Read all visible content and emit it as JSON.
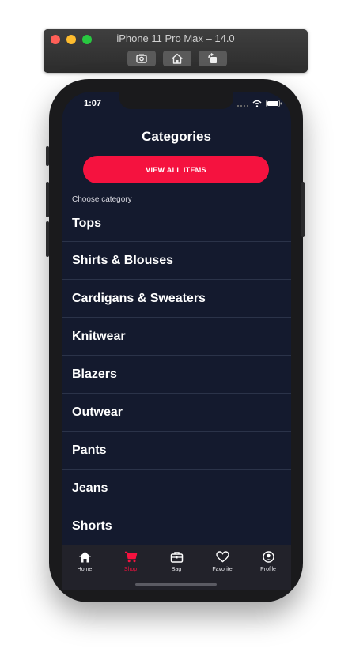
{
  "simulator": {
    "title": "iPhone 11 Pro Max – 14.0",
    "toolbar": [
      "screenshot-icon",
      "home-icon",
      "rotate-icon"
    ]
  },
  "status_bar": {
    "time": "1:07"
  },
  "header": {
    "title": "Categories"
  },
  "actions": {
    "view_all_label": "VIEW ALL ITEMS"
  },
  "category_prompt": "Choose category",
  "categories": [
    "Tops",
    "Shirts & Blouses",
    "Cardigans & Sweaters",
    "Knitwear",
    "Blazers",
    "Outwear",
    "Pants",
    "Jeans",
    "Shorts"
  ],
  "tabbar": {
    "active": "Shop",
    "tabs": [
      {
        "label": "Home",
        "icon": "home-icon"
      },
      {
        "label": "Shop",
        "icon": "cart-icon"
      },
      {
        "label": "Bag",
        "icon": "bag-icon"
      },
      {
        "label": "Favorite",
        "icon": "heart-icon"
      },
      {
        "label": "Profile",
        "icon": "profile-icon"
      }
    ]
  },
  "colors": {
    "background": "#141a2e",
    "accent": "#f5123f",
    "tabbar": "#22222a",
    "divider": "#2b3349"
  }
}
